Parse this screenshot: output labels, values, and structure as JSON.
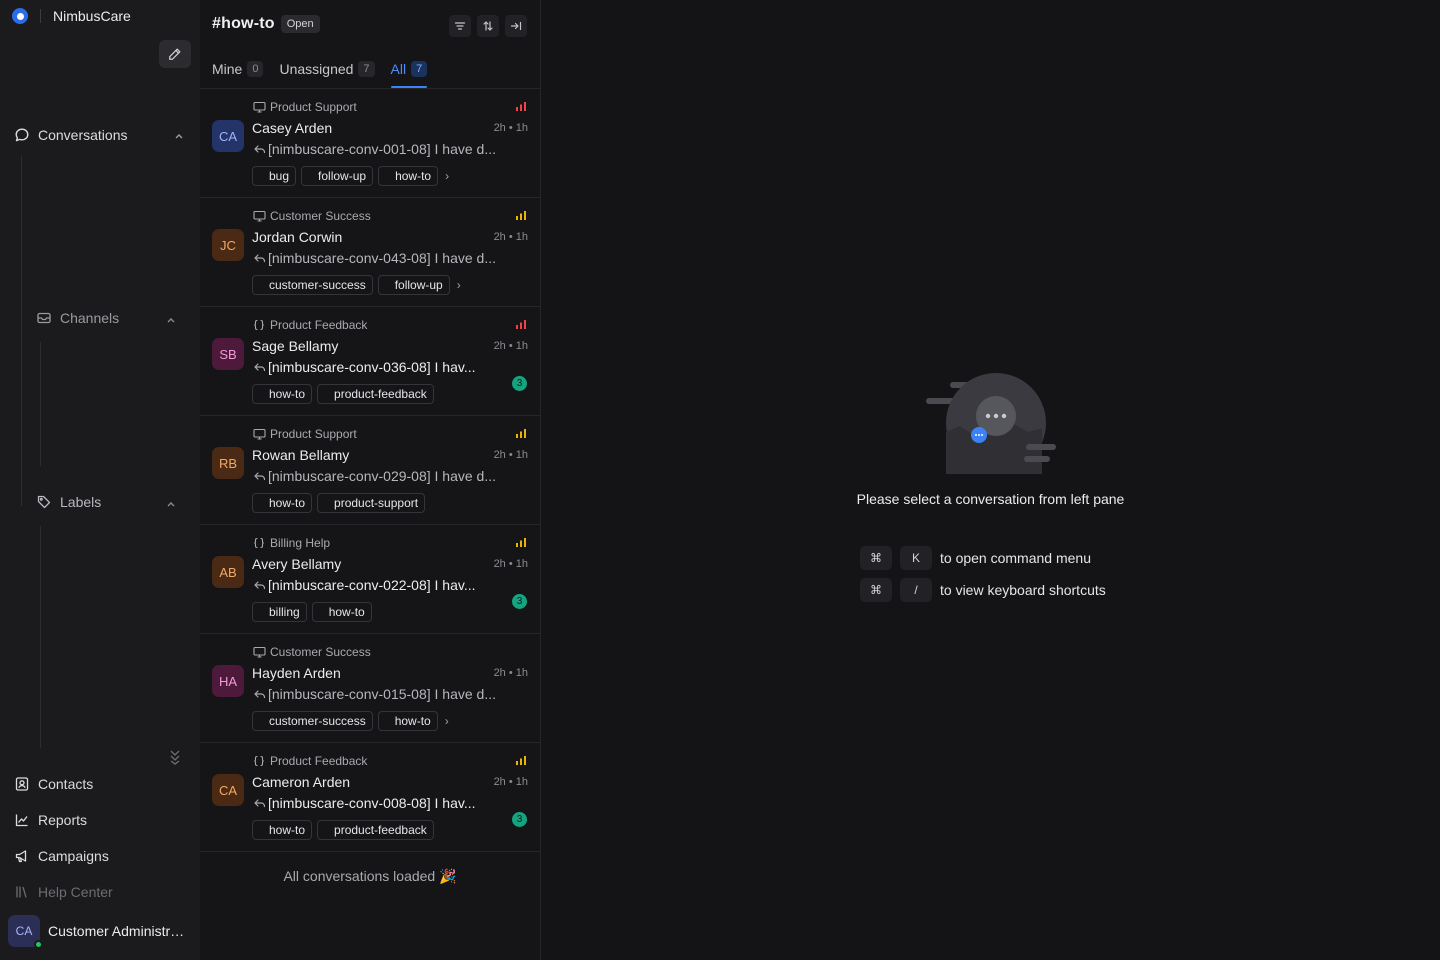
{
  "sidebar": {
    "brand": "NimbusCare",
    "nav": {
      "conversations": "Conversations",
      "channels": "Channels",
      "labels": "Labels",
      "contacts": "Contacts",
      "reports": "Reports",
      "campaigns": "Campaigns",
      "help_center": "Help Center"
    },
    "user": {
      "initials": "CA",
      "name": "Customer Administrator"
    }
  },
  "list": {
    "title": "#how-to",
    "status": "Open",
    "tabs": [
      {
        "label": "Mine",
        "count": "0"
      },
      {
        "label": "Unassigned",
        "count": "7"
      },
      {
        "label": "All",
        "count": "7"
      }
    ],
    "conversations": [
      {
        "initials": "CA",
        "inbox": "Product Support",
        "name": "Casey Arden",
        "time": "2h • 1h",
        "message": "[nimbuscare-conv-001-08] I have d...",
        "labels": [
          "bug",
          "follow-up",
          "how-to"
        ],
        "more": true,
        "unread": "",
        "priority": "high"
      },
      {
        "initials": "JC",
        "inbox": "Customer Success",
        "name": "Jordan Corwin",
        "time": "2h • 1h",
        "message": "[nimbuscare-conv-043-08] I have d...",
        "labels": [
          "customer-success",
          "follow-up"
        ],
        "more": true,
        "unread": "",
        "priority": "medium"
      },
      {
        "initials": "SB",
        "inbox": "Product Feedback",
        "name": "Sage Bellamy",
        "time": "2h • 1h",
        "message": "[nimbuscare-conv-036-08] I hav...",
        "labels": [
          "how-to",
          "product-feedback"
        ],
        "more": false,
        "unread": "3",
        "priority": "high"
      },
      {
        "initials": "RB",
        "inbox": "Product Support",
        "name": "Rowan Bellamy",
        "time": "2h • 1h",
        "message": "[nimbuscare-conv-029-08] I have d...",
        "labels": [
          "how-to",
          "product-support"
        ],
        "more": false,
        "unread": "",
        "priority": "low"
      },
      {
        "initials": "AB",
        "inbox": "Billing Help",
        "name": "Avery Bellamy",
        "time": "2h • 1h",
        "message": "[nimbuscare-conv-022-08] I hav...",
        "labels": [
          "billing",
          "how-to"
        ],
        "more": false,
        "unread": "3",
        "priority": "medium"
      },
      {
        "initials": "HA",
        "inbox": "Customer Success",
        "name": "Hayden Arden",
        "time": "2h • 1h",
        "message": "[nimbuscare-conv-015-08] I have d...",
        "labels": [
          "customer-success",
          "how-to"
        ],
        "more": true,
        "unread": "",
        "priority": ""
      },
      {
        "initials": "CA",
        "inbox": "Product Feedback",
        "name": "Cameron Arden",
        "time": "2h • 1h",
        "message": "[nimbuscare-conv-008-08] I hav...",
        "labels": [
          "how-to",
          "product-feedback"
        ],
        "more": false,
        "unread": "3",
        "priority": "medium"
      }
    ],
    "all_loaded": "All conversations loaded 🎉"
  },
  "empty_state": {
    "title": "Please select a conversation from left pane",
    "shortcuts": [
      {
        "keys": [
          "⌘",
          "K"
        ],
        "text": "to open command menu"
      },
      {
        "keys": [
          "⌘",
          "/"
        ],
        "text": "to view keyboard shortcuts"
      }
    ]
  },
  "colors": {
    "accent": "#3b82f6",
    "priority_high": "#ef4444",
    "priority_medium": "#eab308",
    "unread": "#16a37f",
    "online": "#22c55e"
  }
}
